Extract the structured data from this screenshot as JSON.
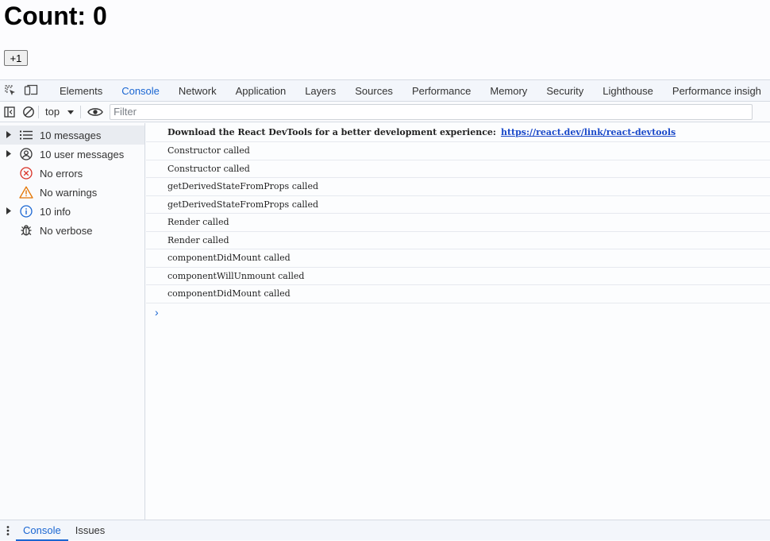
{
  "app": {
    "count_title": "Count: 0",
    "increment_button": "+1"
  },
  "devtools": {
    "tabs": [
      {
        "label": "Elements"
      },
      {
        "label": "Console",
        "active": true
      },
      {
        "label": "Network"
      },
      {
        "label": "Application"
      },
      {
        "label": "Layers"
      },
      {
        "label": "Sources"
      },
      {
        "label": "Performance"
      },
      {
        "label": "Memory"
      },
      {
        "label": "Security"
      },
      {
        "label": "Lighthouse"
      },
      {
        "label": "Performance insigh"
      }
    ],
    "toolbar": {
      "context": "top",
      "filter_placeholder": "Filter"
    },
    "sidebar": [
      {
        "label": "10 messages",
        "icon": "list-icon",
        "expandable": true
      },
      {
        "label": "10 user messages",
        "icon": "user-icon",
        "expandable": true
      },
      {
        "label": "No errors",
        "icon": "error-icon",
        "expandable": false
      },
      {
        "label": "No warnings",
        "icon": "warning-icon",
        "expandable": false
      },
      {
        "label": "10 info",
        "icon": "info-icon",
        "expandable": true
      },
      {
        "label": "No verbose",
        "icon": "bug-icon",
        "expandable": false
      }
    ],
    "console": {
      "banner_text": "Download the React DevTools for a better development experience:",
      "banner_link": "https://react.dev/link/react-devtools",
      "logs": [
        "Constructor called",
        "Constructor called",
        "getDerivedStateFromProps called",
        "getDerivedStateFromProps called",
        "Render called",
        "Render called",
        "componentDidMount called",
        "componentWillUnmount called",
        "componentDidMount called"
      ],
      "prompt_symbol": "›"
    },
    "drawer_tabs": [
      {
        "label": "Console",
        "active": true
      },
      {
        "label": "Issues"
      }
    ],
    "colors": {
      "accent": "#1a66d2",
      "error": "#d93025",
      "warning": "#e37400",
      "info": "#1a66d2"
    }
  }
}
